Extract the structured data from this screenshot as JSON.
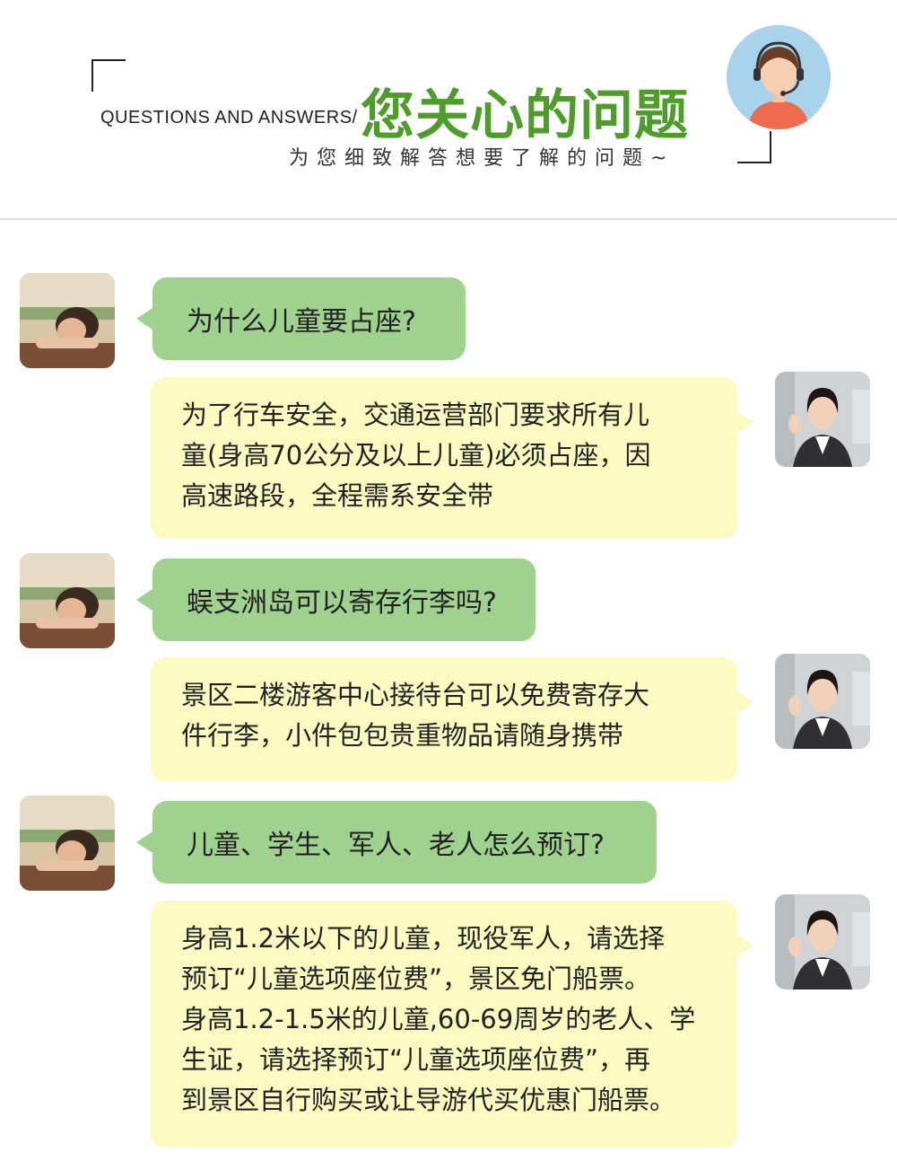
{
  "header": {
    "en_title": "QUESTIONS AND ANSWERS/",
    "cn_title": "您关心的问题",
    "subtitle": "为您细致解答想要了解的问题~",
    "accent_color": "#4e9d2a"
  },
  "colors": {
    "question_bubble": "#9fd28f",
    "answer_bubble": "#fbfac0"
  },
  "icons": {
    "customer_avatar": "user-photo-icon",
    "agent_avatar": "service-agent-photo-icon",
    "header_agent": "headset-agent-icon"
  },
  "qa": [
    {
      "question": "为什么儿童要占座?",
      "answer_lines": [
        "为了行车安全，交通运营部门要求所有儿",
        "童(身高70公分及以上儿童)必须占座，因",
        "高速路段，全程需系安全带"
      ]
    },
    {
      "question": "蜈支洲岛可以寄存行李吗?",
      "answer_lines": [
        "景区二楼游客中心接待台可以免费寄存大",
        "件行李，小件包包贵重物品请随身携带"
      ]
    },
    {
      "question": "儿童、学生、军人、老人怎么预订?",
      "answer_lines": [
        "身高1.2米以下的儿童，现役军人，请选择",
        "预订“儿童选项座位费”，景区免门船票。",
        "身高1.2-1.5米的儿童,60-69周岁的老人、学",
        "生证，请选择预订“儿童选项座位费”，再",
        "到景区自行购买或让导游代买优惠门船票。"
      ]
    }
  ]
}
